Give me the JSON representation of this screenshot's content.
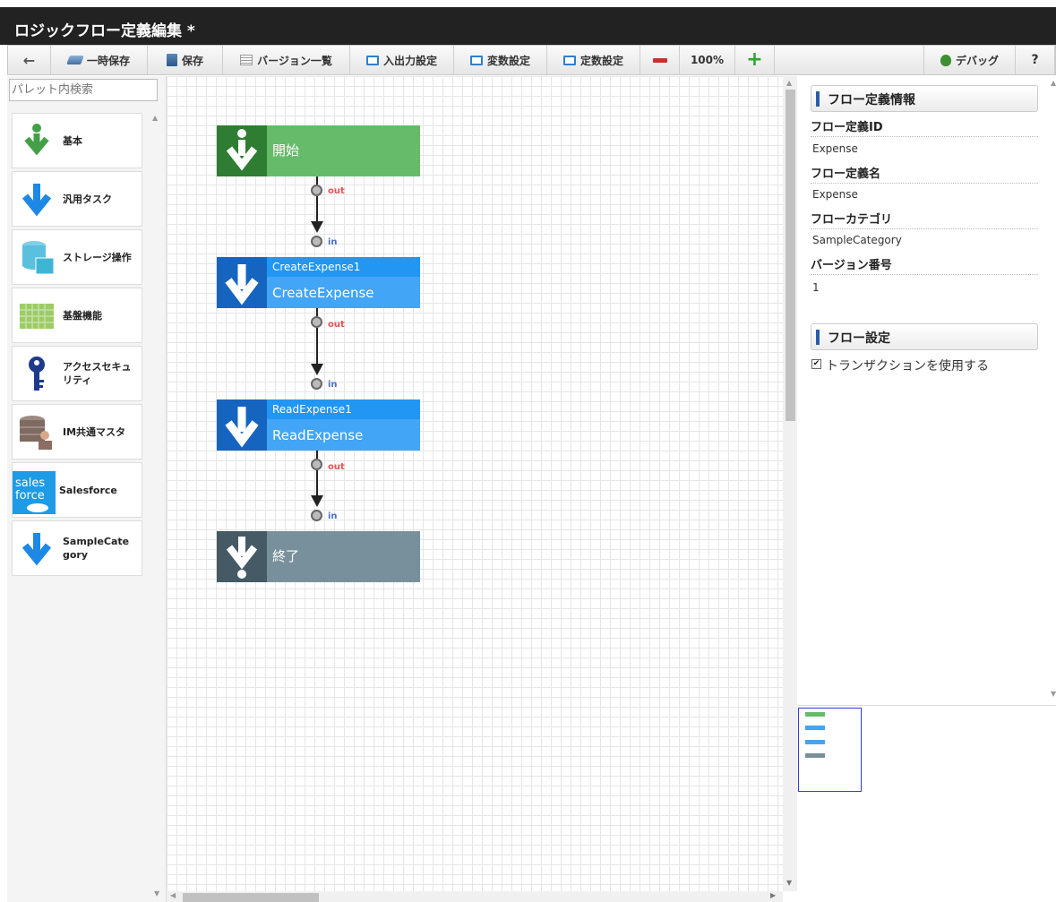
{
  "window": {
    "title": "ロジックフロー定義編集 *"
  },
  "toolbar": {
    "back_label": "",
    "temp_save_label": "一時保存",
    "save_label": "保存",
    "version_list_label": "バージョン一覧",
    "io_settings_label": "入出力設定",
    "variable_settings_label": "変数設定",
    "constant_settings_label": "定数設定",
    "zoom_level": "100%",
    "debug_label": "デバッグ",
    "help_label": "?"
  },
  "palette": {
    "search_placeholder": "パレット内検索",
    "items": [
      {
        "label": "基本",
        "icon": "download-arrow-icon"
      },
      {
        "label": "汎用タスク",
        "icon": "arrow-down-icon"
      },
      {
        "label": "ストレージ操作",
        "icon": "database-icon"
      },
      {
        "label": "基盤機能",
        "icon": "grid-blocks-icon"
      },
      {
        "label": "アクセスセキュリティ",
        "icon": "key-icon"
      },
      {
        "label": "IM共通マスタ",
        "icon": "user-database-icon"
      },
      {
        "label": "Salesforce",
        "icon": "salesforce-icon"
      },
      {
        "label": "SampleCategory",
        "icon": "arrow-down-icon"
      }
    ]
  },
  "flow": {
    "start": {
      "label": "開始",
      "color": "#66bb6a",
      "icon_color": "#2e7d32"
    },
    "tasks": [
      {
        "id": "CreateExpense1",
        "name": "CreateExpense"
      },
      {
        "id": "ReadExpense1",
        "name": "ReadExpense"
      }
    ],
    "end": {
      "label": "終了",
      "color": "#78909c",
      "icon_color": "#455a64"
    },
    "port_out": "out",
    "port_in": "in",
    "task_color": "#42a5f5",
    "task_header_color": "#2196f3",
    "task_icon_color": "#1565c0"
  },
  "properties": {
    "section_info": "フロー定義情報",
    "flow_id_label": "フロー定義ID",
    "flow_id": "Expense",
    "flow_name_label": "フロー定義名",
    "flow_name": "Expense",
    "category_label": "フローカテゴリ",
    "category": "SampleCategory",
    "version_label": "バージョン番号",
    "version": "1",
    "section_settings": "フロー設定",
    "use_transaction_label": "トランザクションを使用する",
    "use_transaction": true
  }
}
